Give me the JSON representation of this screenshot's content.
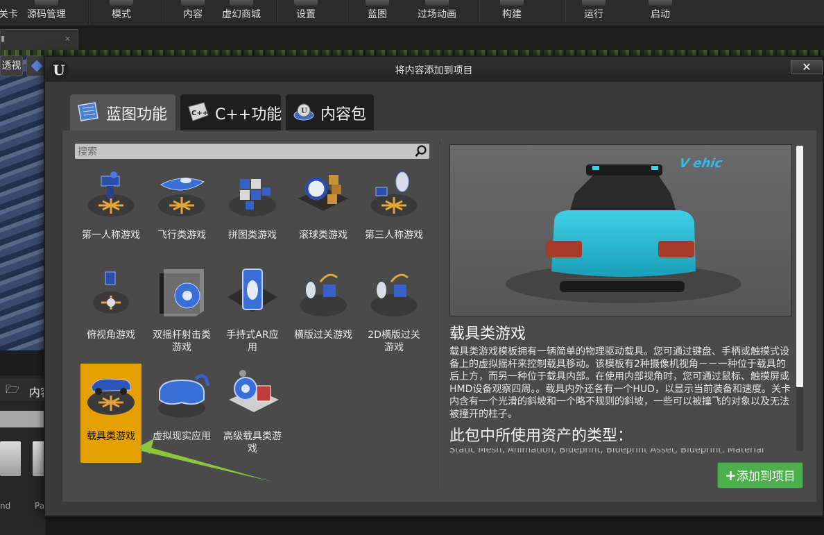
{
  "toolbar": {
    "items": [
      {
        "label": "关卡"
      },
      {
        "label": "源码管理"
      },
      {
        "label": "模式"
      },
      {
        "label": "内容"
      },
      {
        "label": "虚幻商城"
      },
      {
        "label": "设置"
      },
      {
        "label": "蓝图"
      },
      {
        "label": "过场动画"
      },
      {
        "label": "构建"
      },
      {
        "label": "运行"
      },
      {
        "label": "启动"
      }
    ]
  },
  "viewport": {
    "perspective_label": "透视"
  },
  "content_browser": {
    "folder_label": "内容",
    "thumb_labels": [
      "nd",
      "Pa"
    ]
  },
  "doc_tab": {
    "close_glyph": "×"
  },
  "modal": {
    "title": "将内容添加到项目",
    "close_glyph": "✕",
    "tabs": [
      {
        "label": "蓝图功能",
        "active": true
      },
      {
        "label": "C++功能",
        "active": false
      },
      {
        "label": "内容包",
        "active": false
      }
    ],
    "search_placeholder": "搜索",
    "templates": [
      {
        "label": "第一人称游戏",
        "icon": "first-person-icon"
      },
      {
        "label": "飞行类游戏",
        "icon": "flying-icon"
      },
      {
        "label": "拼图类游戏",
        "icon": "puzzle-icon"
      },
      {
        "label": "滚球类游戏",
        "icon": "rolling-icon"
      },
      {
        "label": "第三人称游戏",
        "icon": "third-person-icon"
      },
      {
        "label": "俯视角游戏",
        "icon": "top-down-icon"
      },
      {
        "label": "双摇杆射击类游戏",
        "icon": "twin-stick-icon"
      },
      {
        "label": "手持式AR应用",
        "icon": "handheld-ar-icon"
      },
      {
        "label": "横版过关游戏",
        "icon": "side-scroller-icon"
      },
      {
        "label": "2D横版过关游戏",
        "icon": "2d-side-scroller-icon"
      },
      {
        "label": "载具类游戏",
        "icon": "vehicle-icon",
        "selected": true
      },
      {
        "label": "虚拟现实应用",
        "icon": "vr-icon"
      },
      {
        "label": "高级载具类游戏",
        "icon": "advanced-vehicle-icon"
      }
    ],
    "detail": {
      "title": "载具类游戏",
      "description": "载具类游戏模板拥有一辆简单的物理驱动载具。您可通过键盘、手柄或触摸式设备上的虚拟摇杆来控制载具移动。该模板有2种摄像机视角－－一种位于载具的后上方，而另一种位于载具内部。在使用内部视角时，您可通过鼠标、触摸屏或HMD设备观察四周。。载具内外还各有一个HUD，以显示当前装备和速度。关卡内含有一个光滑的斜坡和一个略不规则的斜坡，一些可以被撞飞的对象以及无法被撞开的柱子。",
      "assets_heading": "此包中所使用资产的类型：",
      "assets_line": "Static Mesh, Animation, Blueprint, Blueprint Asset, Blueprint, Material"
    },
    "add_button": {
      "plus": "+",
      "label": "添加到项目"
    }
  },
  "colors": {
    "selected_tile": "#e5a000",
    "add_button": "#4cae4c",
    "arrow": "#8cc63f"
  }
}
